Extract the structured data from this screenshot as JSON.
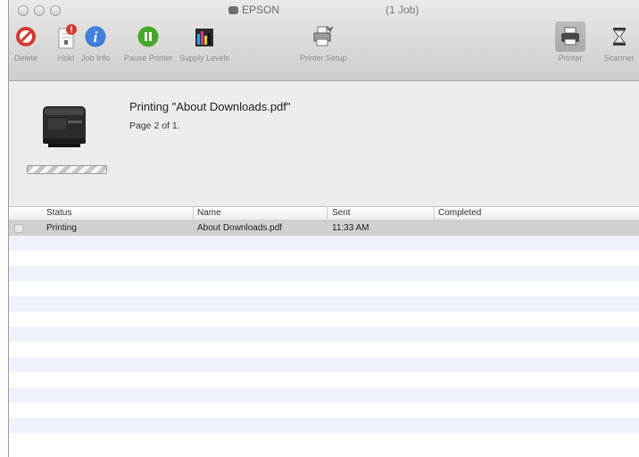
{
  "window": {
    "app_name": "EPSON",
    "job_count": "(1 Job)"
  },
  "toolbar": {
    "delete": "Delete",
    "hold": "Hold",
    "job_info": "Job Info",
    "pause_printer": "Pause Printer",
    "supply_levels": "Supply Levels",
    "printer_setup": "Printer Setup",
    "printer": "Printer",
    "scanner": "Scanner"
  },
  "status_panel": {
    "doc_title": "Printing \"About Downloads.pdf\"",
    "page_status": "Page 2 of 1."
  },
  "table": {
    "columns": [
      "Status",
      "Name",
      "Sent",
      "Completed"
    ],
    "rows": [
      {
        "status": "Printing",
        "name": "About Downloads.pdf",
        "sent": "11:33 AM",
        "completed": ""
      }
    ]
  },
  "colors": {
    "delete_red": "#d23a32",
    "info_blue": "#2f6fd0",
    "pause_green": "#46a829",
    "selected_row": "#d0d0d0",
    "stripe": "#eef3fb"
  }
}
